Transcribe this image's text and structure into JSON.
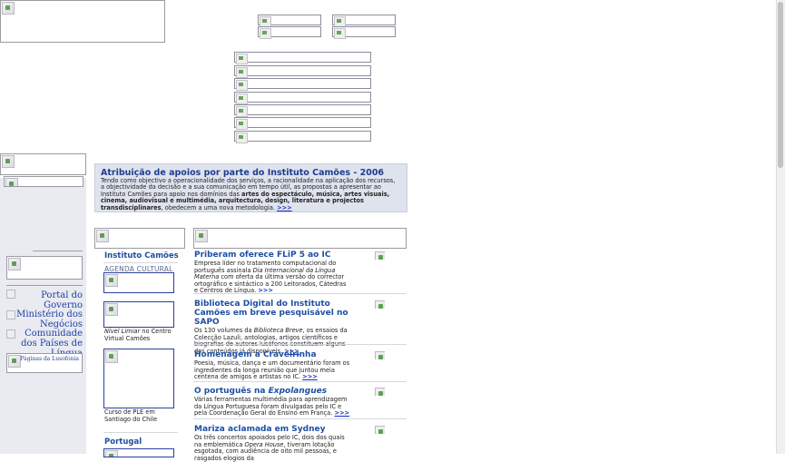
{
  "banner": {
    "title": "Atribuição de apoios por parte do Instituto Camões - 2006",
    "text_before_bold": "Tendo como objectivo a operacionalidade dos serviços, a racionalidade na aplicação dos recursos, a objectividade da decisão e a sua comunicação em tempo útil, as propostas a apresentar ao Instituto Camões para apoio nos domínios das ",
    "text_bold": "artes do espectáculo, música, artes visuais, cinema, audiovisual e multimédia, arquitectura, design, literatura e projectos transdisciplinares",
    "text_after_bold": ", obedecem a uma nova metodologia. ",
    "more": ">>>"
  },
  "left_links": [
    {
      "label": "Portal do Governo"
    },
    {
      "label": "Ministério dos Negócios"
    },
    {
      "label": "Comunidade dos Países de Língua"
    },
    {
      "label": "Páginas da Lusofonia"
    }
  ],
  "instituto": {
    "heading": "Instituto Camões",
    "agenda": "AGENDA CULTURAL",
    "caption1_italic": "Nível Limiar",
    "caption1_rest": " no Centro Virtual Camões",
    "caption2": "Curso de PLE em Santiago do Chile",
    "portugal": "Portugal"
  },
  "news": [
    {
      "title": "Priberam oferece FLiP 5 ao IC",
      "body_pre": "Empresa líder no tratamento computacional do português assinala ",
      "body_italic": "Dia Internacional da Língua Materna",
      "body_post": " com oferta da última versão do corrector ortográfico e sintáctico a 200 Leitorados, Cátedras e Centros de Língua. ",
      "more": ">>>"
    },
    {
      "title": "Biblioteca Digital do Instituto Camões em breve pesquisável no SAPO",
      "body_pre": "Os 130 volumes da ",
      "body_italic": "Biblioteca Breve",
      "body_post": ", os ensaios da Colecção Lazuli, antologias, artigos científicos e biografias de autores lusófonos constituem alguns dos conteúdos já disponíveis. ",
      "more": ">>>"
    },
    {
      "title": "Homenagem a Craveirinha",
      "body_pre": "Poesia, música, dança e um documentário foram os ingredientes da longa reunião que juntou meia centena de amigos e artistas no IC. ",
      "body_italic": "",
      "body_post": "",
      "more": ">>>"
    },
    {
      "title_pre": "O português na ",
      "title_italic": "Expolangues",
      "body_pre": "Várias ferramentas multimédia para aprendizagem da Língua Portuguesa foram divulgadas pelo IC e pela Coordenação Geral do Ensino em França. ",
      "body_italic": "",
      "body_post": "",
      "more": ">>>"
    },
    {
      "title": "Mariza aclamada em Sydney",
      "body_pre": "Os três concertos apoiados pelo IC, dois dos quais na emblemática ",
      "body_italic": "Opera House",
      "body_post": ", tiveram lotação esgotada, com audiência de oito mil pessoas, e rasgados elogios da",
      "more": ""
    }
  ]
}
